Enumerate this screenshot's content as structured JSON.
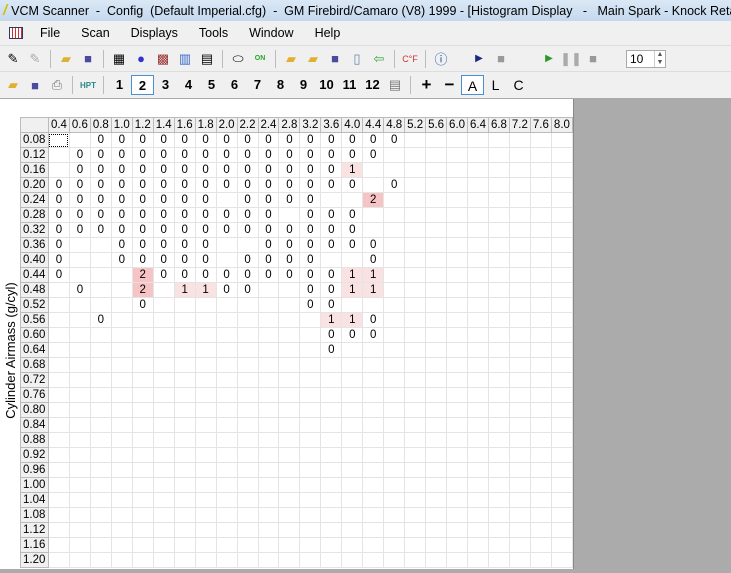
{
  "title": "VCM Scanner  -  Config  (Default Imperial.cfg)  -  GM Firebird/Camaro (V8) 1999 - [Histogram Display   -   Main Spark - Knock Retard]",
  "menu": [
    "File",
    "Scan",
    "Displays",
    "Tools",
    "Window",
    "Help"
  ],
  "toolbar1": {
    "interval_value": "10"
  },
  "toolbar2": {
    "pages": [
      "1",
      "2",
      "3",
      "4",
      "5",
      "6",
      "7",
      "8",
      "9",
      "10",
      "11",
      "12"
    ],
    "selected_page": "2",
    "modes": [
      "A",
      "L",
      "C"
    ],
    "selected_mode": "A",
    "plus": "+",
    "minus": "−"
  },
  "histogram": {
    "y_axis_label": "Cylinder Airmass (g/cyl)",
    "columns": [
      "0.4",
      "0.6",
      "0.8",
      "1.0",
      "1.2",
      "1.4",
      "1.6",
      "1.8",
      "2.0",
      "2.2",
      "2.4",
      "2.8",
      "3.2",
      "3.6",
      "4.0",
      "4.4",
      "4.8",
      "5.2",
      "5.6",
      "6.0",
      "6.4",
      "6.8",
      "7.2",
      "7.6",
      "8.0"
    ],
    "rows": [
      {
        "label": "0.08",
        "cells": [
          null,
          null,
          0,
          0,
          0,
          0,
          0,
          0,
          0,
          0,
          0,
          0,
          0,
          0,
          0,
          0,
          0
        ]
      },
      {
        "label": "0.12",
        "cells": [
          null,
          0,
          0,
          0,
          0,
          0,
          0,
          0,
          0,
          0,
          0,
          0,
          0,
          0,
          0,
          0
        ]
      },
      {
        "label": "0.16",
        "cells": [
          null,
          0,
          0,
          0,
          0,
          0,
          0,
          0,
          0,
          0,
          0,
          0,
          0,
          0,
          1
        ]
      },
      {
        "label": "0.20",
        "cells": [
          0,
          0,
          0,
          0,
          0,
          0,
          0,
          0,
          0,
          0,
          0,
          0,
          0,
          0,
          0,
          null,
          0
        ]
      },
      {
        "label": "0.24",
        "cells": [
          0,
          0,
          0,
          0,
          0,
          0,
          0,
          0,
          null,
          0,
          0,
          0,
          0,
          null,
          null,
          2
        ]
      },
      {
        "label": "0.28",
        "cells": [
          0,
          0,
          0,
          0,
          0,
          0,
          0,
          0,
          0,
          0,
          0,
          null,
          0,
          0,
          0
        ]
      },
      {
        "label": "0.32",
        "cells": [
          0,
          0,
          0,
          0,
          0,
          0,
          0,
          0,
          0,
          0,
          0,
          0,
          0,
          0,
          0
        ]
      },
      {
        "label": "0.36",
        "cells": [
          0,
          null,
          null,
          0,
          0,
          0,
          0,
          0,
          null,
          null,
          0,
          0,
          0,
          0,
          0,
          0
        ]
      },
      {
        "label": "0.40",
        "cells": [
          0,
          null,
          null,
          0,
          0,
          0,
          0,
          0,
          null,
          0,
          0,
          0,
          0,
          null,
          null,
          0
        ]
      },
      {
        "label": "0.44",
        "cells": [
          0,
          null,
          null,
          null,
          2,
          0,
          0,
          0,
          0,
          0,
          0,
          0,
          0,
          0,
          1,
          1
        ]
      },
      {
        "label": "0.48",
        "cells": [
          null,
          0,
          null,
          null,
          2,
          null,
          1,
          1,
          0,
          0,
          null,
          null,
          0,
          0,
          1,
          1
        ]
      },
      {
        "label": "0.52",
        "cells": [
          null,
          null,
          null,
          null,
          0,
          null,
          null,
          null,
          null,
          null,
          null,
          null,
          0,
          0
        ]
      },
      {
        "label": "0.56",
        "cells": [
          null,
          null,
          0,
          null,
          null,
          null,
          null,
          null,
          null,
          null,
          null,
          null,
          null,
          1,
          1,
          0
        ]
      },
      {
        "label": "0.60",
        "cells": [
          null,
          null,
          null,
          null,
          null,
          null,
          null,
          null,
          null,
          null,
          null,
          null,
          null,
          0,
          0,
          0
        ]
      },
      {
        "label": "0.64",
        "cells": [
          null,
          null,
          null,
          null,
          null,
          null,
          null,
          null,
          null,
          null,
          null,
          null,
          null,
          0
        ]
      },
      {
        "label": "0.68",
        "cells": []
      },
      {
        "label": "0.72",
        "cells": []
      },
      {
        "label": "0.76",
        "cells": []
      },
      {
        "label": "0.80",
        "cells": []
      },
      {
        "label": "0.84",
        "cells": []
      },
      {
        "label": "0.88",
        "cells": []
      },
      {
        "label": "0.92",
        "cells": []
      },
      {
        "label": "0.96",
        "cells": []
      },
      {
        "label": "1.00",
        "cells": []
      },
      {
        "label": "1.04",
        "cells": []
      },
      {
        "label": "1.08",
        "cells": []
      },
      {
        "label": "1.12",
        "cells": []
      },
      {
        "label": "1.16",
        "cells": []
      },
      {
        "label": "1.20",
        "cells": []
      }
    ]
  },
  "colors": {
    "count_1": "#fbe2e2",
    "count_2": "#f6c4c4"
  }
}
